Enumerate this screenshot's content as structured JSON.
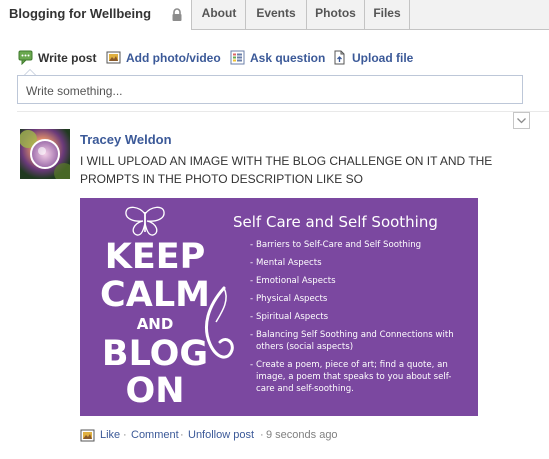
{
  "group": {
    "title": "Blogging for Wellbeing"
  },
  "tabs": [
    {
      "label": "About"
    },
    {
      "label": "Events"
    },
    {
      "label": "Photos"
    },
    {
      "label": "Files"
    }
  ],
  "publisher": {
    "actions": [
      {
        "label": "Write post",
        "icon": "speech-bubble-icon"
      },
      {
        "label": "Add photo/video",
        "icon": "photo-icon"
      },
      {
        "label": "Ask question",
        "icon": "list-icon"
      },
      {
        "label": "Upload file",
        "icon": "file-icon"
      }
    ],
    "placeholder": "Write something..."
  },
  "post": {
    "author": "Tracey Weldon",
    "text": "I WILL UPLOAD AN IMAGE WITH THE BLOG CHALLENGE ON IT AND THE PROMPTS IN THE PHOTO DESCRIPTION LIKE SO",
    "image": {
      "keep_calm": [
        "KEEP",
        "CALM",
        "AND",
        "BLOG",
        "ON"
      ],
      "heading": "Self Care and Self Soothing",
      "bullets": [
        "Barriers to Self-Care and Self Soothing",
        "Mental Aspects",
        "Emotional Aspects",
        "Physical Aspects",
        "Spiritual Aspects",
        "Balancing Self Soothing and Connections with others (social aspects)",
        "Create a poem, piece of art; find a quote, an image, a poem that speaks to you about self-care and self-soothing."
      ]
    },
    "footer": {
      "like": "Like",
      "comment": "Comment",
      "unfollow": "Unfollow post",
      "time": "9 seconds ago"
    }
  },
  "colors": {
    "link": "#3b5998",
    "image_bg": "#7b48a0",
    "tab_bg": "#f2f2f2"
  }
}
